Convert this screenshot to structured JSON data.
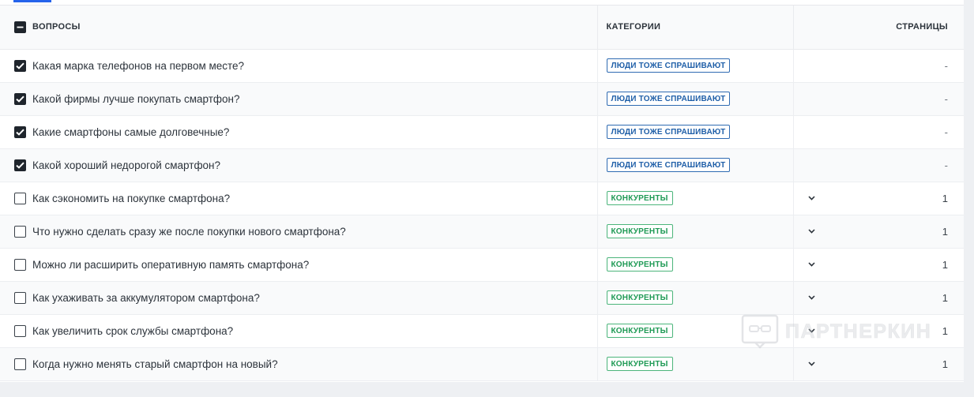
{
  "table": {
    "headers": {
      "questions": "ВОПРОСЫ",
      "categories": "КАТЕГОРИИ",
      "pages": "СТРАНИЦЫ"
    },
    "select_all_state": "indeterminate",
    "rows": [
      {
        "question": "Какая марка телефонов на первом месте?",
        "checked": true,
        "category": "ЛЮДИ ТОЖЕ СПРАШИВАЮТ",
        "category_type": "people",
        "expandable": false,
        "pages": "-"
      },
      {
        "question": "Какой фирмы лучше покупать смартфон?",
        "checked": true,
        "category": "ЛЮДИ ТОЖЕ СПРАШИВАЮТ",
        "category_type": "people",
        "expandable": false,
        "pages": "-"
      },
      {
        "question": "Какие смартфоны самые долговечные?",
        "checked": true,
        "category": "ЛЮДИ ТОЖЕ СПРАШИВАЮТ",
        "category_type": "people",
        "expandable": false,
        "pages": "-"
      },
      {
        "question": "Какой хороший недорогой смартфон?",
        "checked": true,
        "category": "ЛЮДИ ТОЖЕ СПРАШИВАЮТ",
        "category_type": "people",
        "expandable": false,
        "pages": "-"
      },
      {
        "question": "Как сэкономить на покупке смартфона?",
        "checked": false,
        "category": "КОНКУРЕНТЫ",
        "category_type": "competitors",
        "expandable": true,
        "pages": "1"
      },
      {
        "question": "Что нужно сделать сразу же после покупки нового смартфона?",
        "checked": false,
        "category": "КОНКУРЕНТЫ",
        "category_type": "competitors",
        "expandable": true,
        "pages": "1"
      },
      {
        "question": "Можно ли расширить оперативную память смартфона?",
        "checked": false,
        "category": "КОНКУРЕНТЫ",
        "category_type": "competitors",
        "expandable": true,
        "pages": "1"
      },
      {
        "question": "Как ухаживать за аккумулятором смартфона?",
        "checked": false,
        "category": "КОНКУРЕНТЫ",
        "category_type": "competitors",
        "expandable": true,
        "pages": "1"
      },
      {
        "question": "Как увеличить срок службы смартфона?",
        "checked": false,
        "category": "КОНКУРЕНТЫ",
        "category_type": "competitors",
        "expandable": true,
        "pages": "1"
      },
      {
        "question": "Когда нужно менять старый смартфон на новый?",
        "checked": false,
        "category": "КОНКУРЕНТЫ",
        "category_type": "competitors",
        "expandable": true,
        "pages": "1"
      }
    ]
  },
  "watermark": {
    "text": "ПАРТНЕРКИН",
    "icon": "vr-glasses-logo"
  },
  "colors": {
    "people_badge": "#1f5fa8",
    "competitors_badge": "#1f9a55",
    "checkbox_checked": "#1f252c",
    "tab_accent": "#2563eb"
  }
}
